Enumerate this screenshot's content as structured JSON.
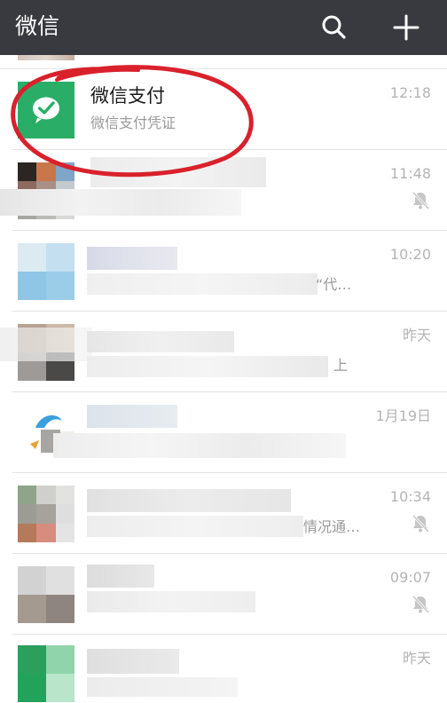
{
  "topbar": {
    "title": "微信",
    "search_icon": "search-icon",
    "add_icon": "plus-icon",
    "background": "#393a3f"
  },
  "chats": [
    {
      "id": "wechat-pay",
      "name": "微信支付",
      "preview": "微信支付凭证",
      "time": "12:18",
      "muted": false
    },
    {
      "id": "chat-2",
      "name": "",
      "preview": "",
      "time": "11:48",
      "muted": true
    },
    {
      "id": "chat-3",
      "name": "",
      "preview": "“代…",
      "time": "10:20",
      "muted": false
    },
    {
      "id": "chat-4",
      "name": "",
      "preview": "上",
      "time": "昨天",
      "muted": false
    },
    {
      "id": "chat-5",
      "name": "",
      "preview": "",
      "time": "1月19日",
      "muted": false
    },
    {
      "id": "chat-6",
      "name": "",
      "preview": "情况通…",
      "time": "10:34",
      "muted": true
    },
    {
      "id": "chat-7",
      "name": "",
      "preview": "",
      "time": "09:07",
      "muted": true
    },
    {
      "id": "chat-8",
      "name": "",
      "preview": "",
      "time": "昨天",
      "muted": false
    }
  ],
  "colors": {
    "wechat_pay_green": "#2aae67",
    "annotation_red": "#d9212c",
    "time_gray": "#b4b4b4",
    "preview_gray": "#9a9a9a"
  }
}
